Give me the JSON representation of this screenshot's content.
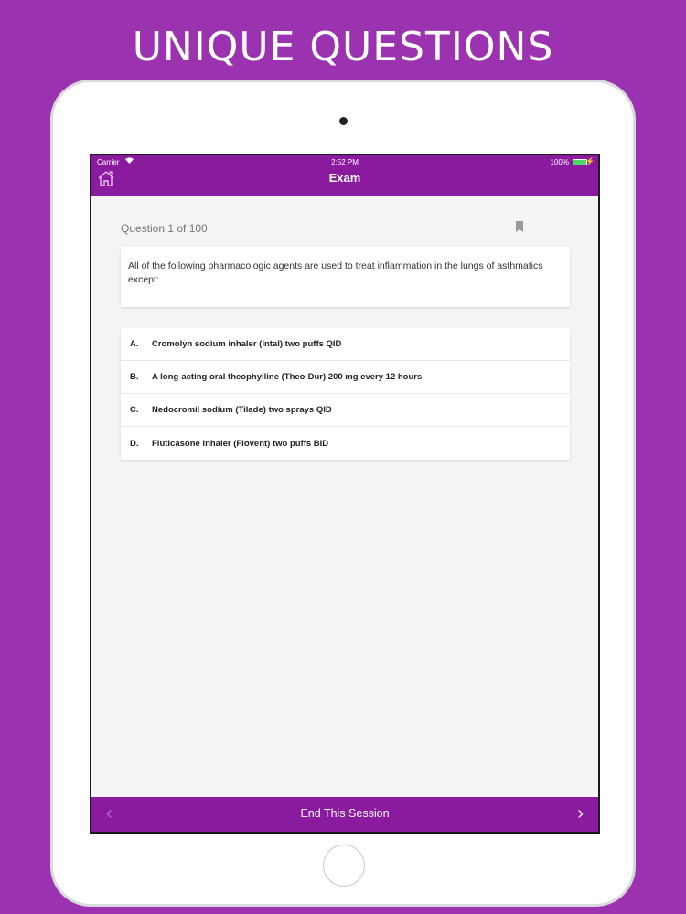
{
  "promo": {
    "headline": "UNIQUE QUESTIONS"
  },
  "status_bar": {
    "carrier": "Carrier",
    "time": "2:52 PM",
    "battery": "100%"
  },
  "navbar": {
    "title": "Exam",
    "home_icon": "home-icon"
  },
  "question": {
    "header": "Question 1 of 100",
    "text": "All of the following pharmacologic agents are used to treat inflammation in the lungs of asthmatics except:",
    "bookmark_icon": "bookmark-icon"
  },
  "answers": [
    {
      "letter": "A.",
      "text": "Cromolyn sodium inhaler (Intal) two puffs QID"
    },
    {
      "letter": "B.",
      "text": "A long-acting oral theophylline (Theo-Dur) 200 mg every 12 hours"
    },
    {
      "letter": "C.",
      "text": "Nedocromil sodium (Tilade) two sprays QID"
    },
    {
      "letter": "D.",
      "text": "Fluticasone inhaler (Flovent) two puffs BID"
    }
  ],
  "bottom_bar": {
    "end_session": "End This Session"
  },
  "colors": {
    "background": "#9b33b0",
    "accent": "#8a1a9e",
    "battery": "#4cd964"
  }
}
